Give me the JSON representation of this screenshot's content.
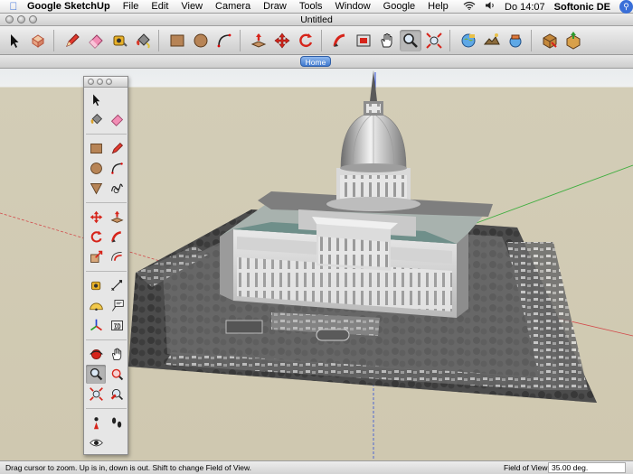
{
  "menubar": {
    "app_name": "Google SketchUp",
    "menus": [
      "File",
      "Edit",
      "View",
      "Camera",
      "Draw",
      "Tools",
      "Window",
      "Google",
      "Help"
    ],
    "clock": "Do 14:07",
    "user": "Softonic DE"
  },
  "window": {
    "title": "Untitled"
  },
  "toolbar": {
    "tools": [
      "select-icon",
      "make-component-icon",
      "pencil-icon",
      "eraser-icon",
      "tape-measure-icon",
      "paint-bucket-icon",
      "rectangle-icon",
      "circle-icon",
      "arc-icon",
      "push-pull-icon",
      "move-icon",
      "rotate-icon",
      "follow-me-icon",
      "offset-icon",
      "pan-icon",
      "zoom-icon",
      "zoom-extents-icon",
      "get-current-view-icon",
      "toggle-terrain-icon",
      "place-model-icon",
      "get-models-icon",
      "share-model-icon"
    ]
  },
  "scenes": {
    "tabs": [
      "Home"
    ]
  },
  "palette": {
    "tools": [
      "select",
      "blank",
      "paint",
      "eraser",
      "rectangle",
      "line",
      "circle",
      "arc",
      "polygon",
      "freehand",
      "move",
      "push-pull",
      "rotate",
      "follow-me",
      "scale",
      "offset",
      "tape",
      "dimension",
      "protractor",
      "text",
      "axes",
      "3d-text",
      "orbit",
      "pan",
      "zoom",
      "zoom-window",
      "zoom-extents",
      "previous",
      "position-camera",
      "walk",
      "look-around"
    ]
  },
  "status": {
    "hint": "Drag cursor to zoom.  Up is in, down is out. Shift to change Field of View.",
    "vcb_label": "Field of View",
    "vcb_value": "35.00 deg."
  },
  "colors": {
    "accent": "#3f79cf",
    "ground": "#cfc8b0",
    "sky": "#eef0f1"
  }
}
